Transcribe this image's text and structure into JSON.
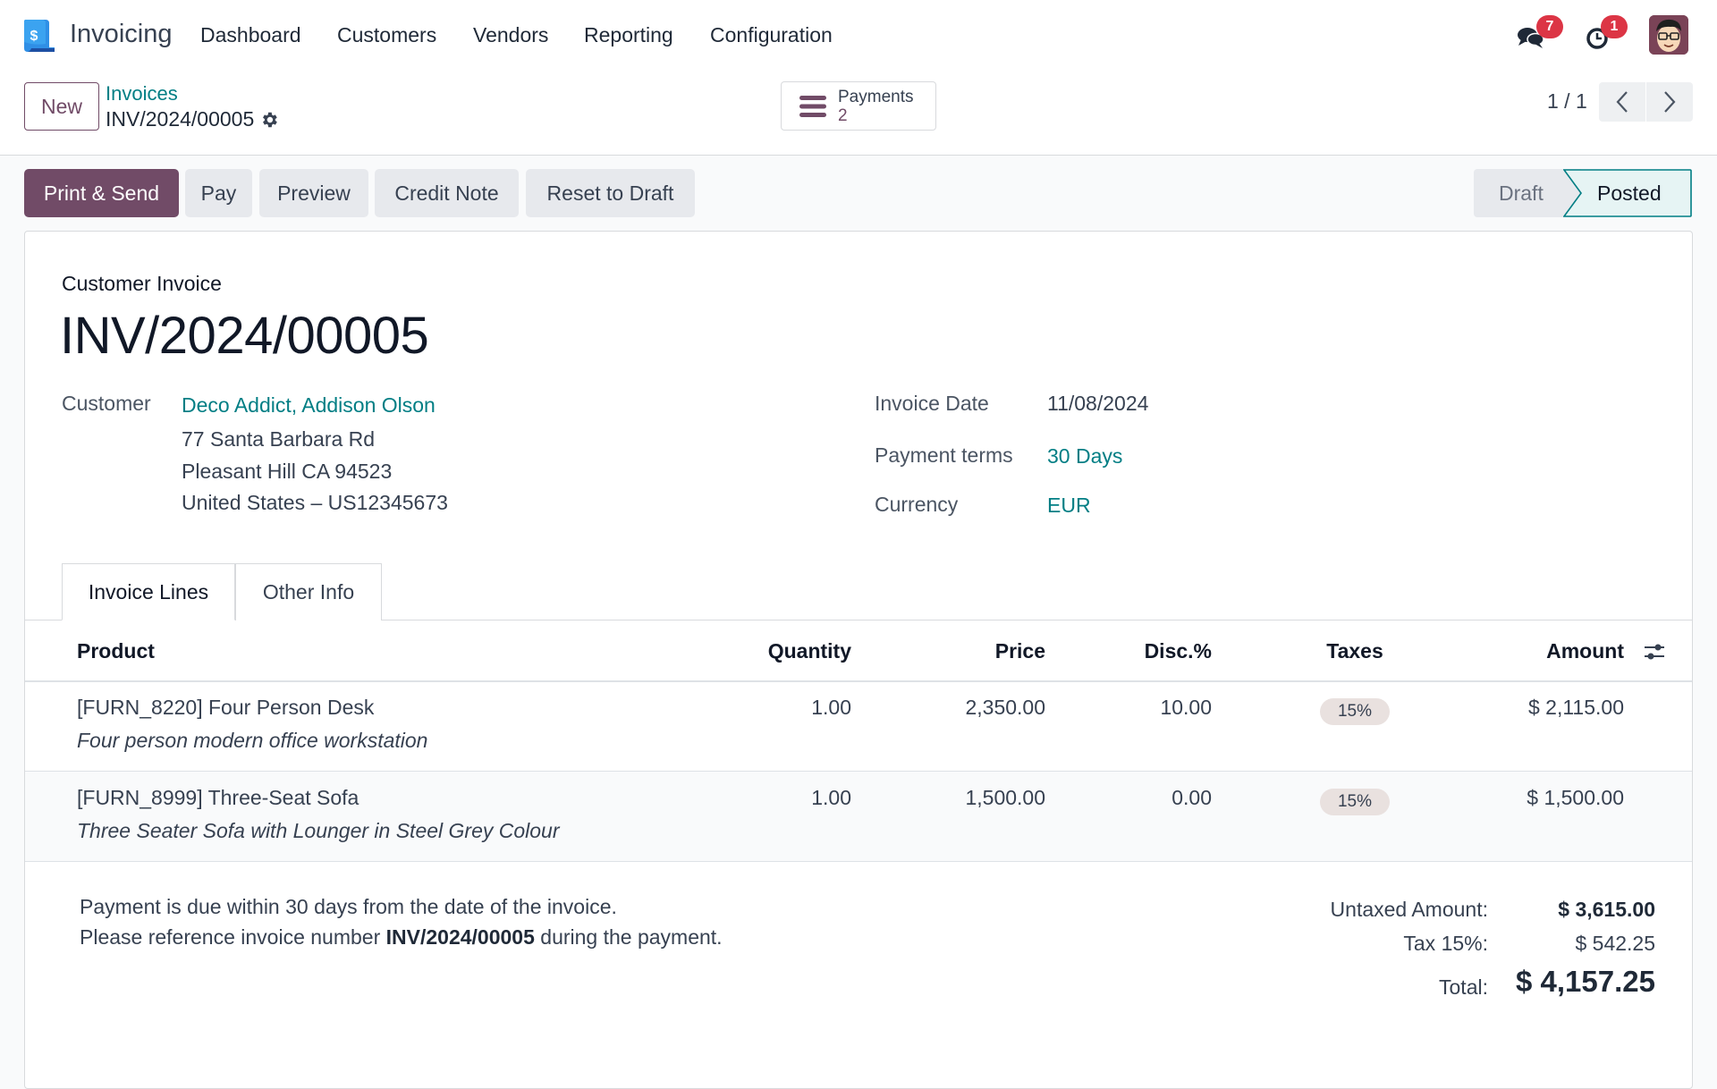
{
  "navbar": {
    "app_name": "Invoicing",
    "menu": [
      "Dashboard",
      "Customers",
      "Vendors",
      "Reporting",
      "Configuration"
    ],
    "messages_count": "7",
    "activities_count": "1"
  },
  "control_panel": {
    "new_label": "New",
    "breadcrumb_parent": "Invoices",
    "breadcrumb_current": "INV/2024/00005",
    "payments_label": "Payments",
    "payments_count": "2",
    "pager_value": "1 / 1"
  },
  "actions": {
    "print_send": "Print & Send",
    "pay": "Pay",
    "preview": "Preview",
    "credit_note": "Credit Note",
    "reset_to_draft": "Reset to Draft"
  },
  "status": {
    "stages": [
      "Draft",
      "Posted"
    ],
    "current": "Posted"
  },
  "invoice": {
    "type": "Customer Invoice",
    "number": "INV/2024/00005",
    "customer_label": "Customer",
    "customer_name": "Deco Addict, Addison Olson",
    "address": [
      "77 Santa Barbara Rd",
      "Pleasant Hill CA 94523",
      "United States – US12345673"
    ],
    "invoice_date_label": "Invoice Date",
    "invoice_date": "11/08/2024",
    "payment_terms_label": "Payment terms",
    "payment_terms": "30 Days",
    "currency_label": "Currency",
    "currency": "EUR"
  },
  "tabs": [
    "Invoice Lines",
    "Other Info"
  ],
  "table": {
    "columns": [
      "Product",
      "Quantity",
      "Price",
      "Disc.%",
      "Taxes",
      "Amount"
    ],
    "rows": [
      {
        "product": "[FURN_8220] Four Person Desk",
        "description": "Four person modern office workstation",
        "quantity": "1.00",
        "price": "2,350.00",
        "discount": "10.00",
        "taxes": "15%",
        "amount": "$ 2,115.00"
      },
      {
        "product": "[FURN_8999] Three-Seat Sofa",
        "description": "Three Seater Sofa with Lounger in Steel Grey Colour",
        "quantity": "1.00",
        "price": "1,500.00",
        "discount": "0.00",
        "taxes": "15%",
        "amount": "$ 1,500.00"
      }
    ]
  },
  "notes": {
    "line1": "Payment is due within 30 days from the date of the invoice.",
    "line2_prefix": "Please reference invoice number ",
    "line2_ref": "INV/2024/00005",
    "line2_suffix": " during the payment."
  },
  "totals": {
    "untaxed_label": "Untaxed Amount:",
    "untaxed_value": "$ 3,615.00",
    "tax_label": "Tax 15%:",
    "tax_value": "$ 542.25",
    "total_label": "Total:",
    "total_value": "$ 4,157.25"
  },
  "colors": {
    "brand": "#714b67",
    "link": "#017e84",
    "badge": "#dc3545"
  }
}
